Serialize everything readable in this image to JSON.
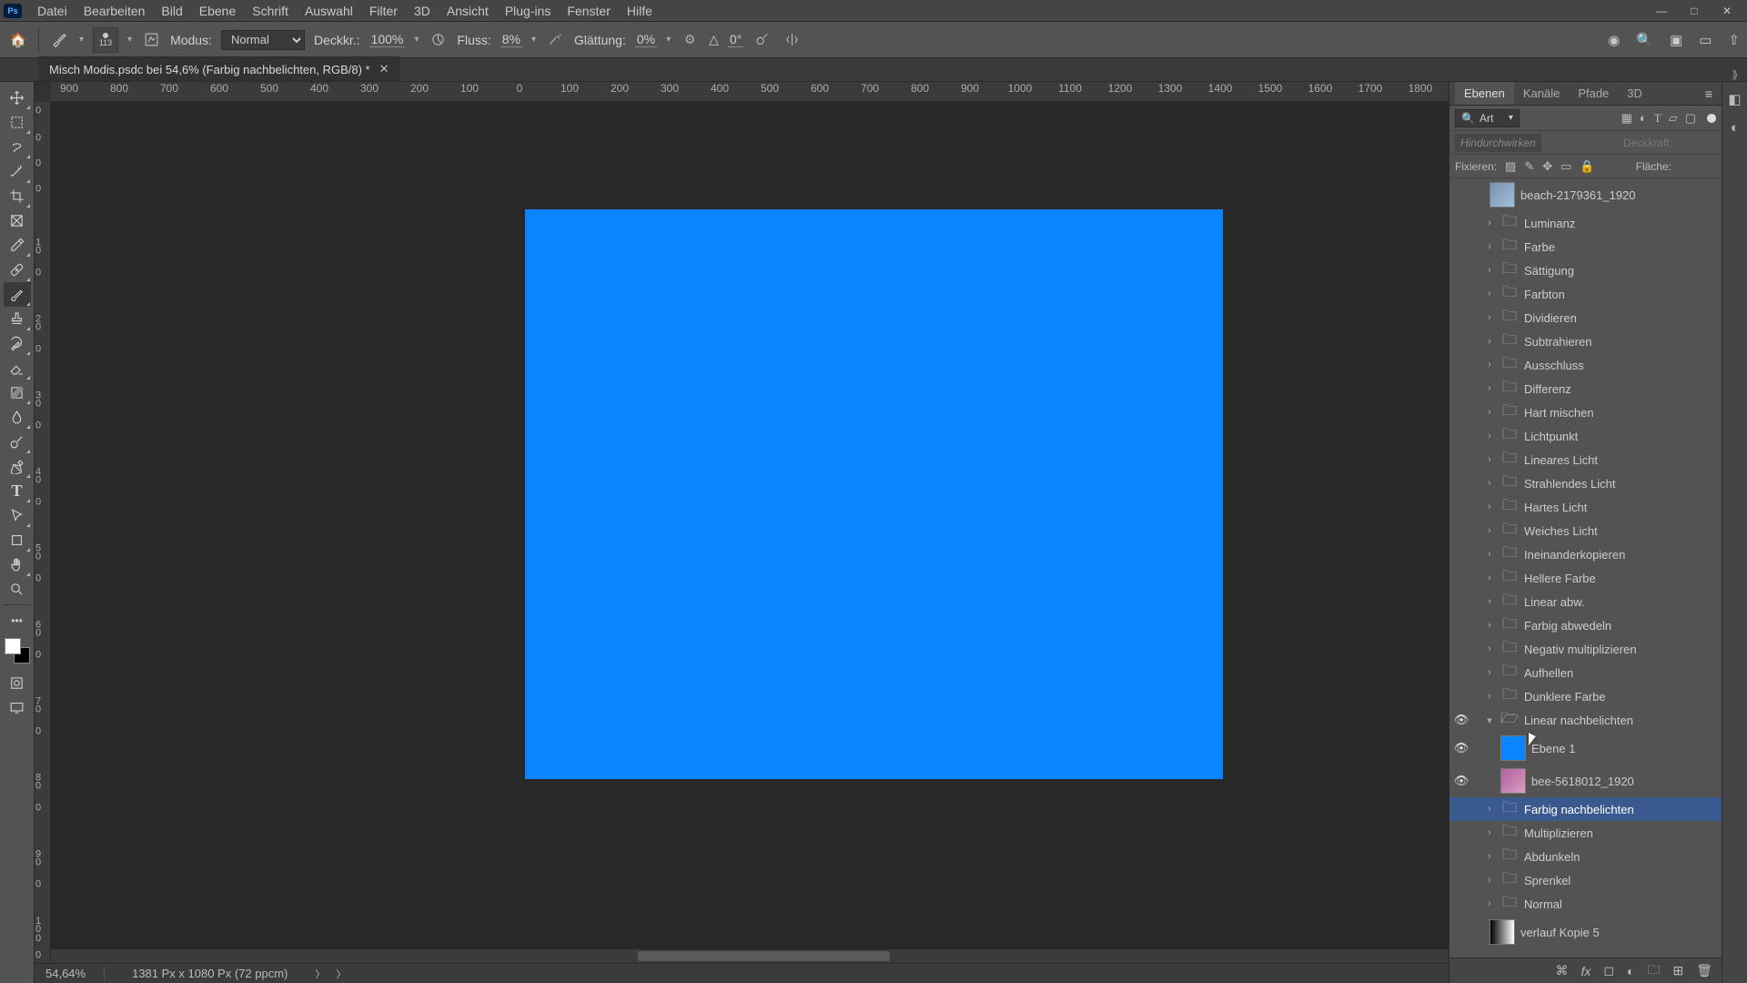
{
  "app": {
    "logo": "Ps"
  },
  "menus": [
    "Datei",
    "Bearbeiten",
    "Bild",
    "Ebene",
    "Schrift",
    "Auswahl",
    "Filter",
    "3D",
    "Ansicht",
    "Plug-ins",
    "Fenster",
    "Hilfe"
  ],
  "options": {
    "brush_size": "113",
    "mode_label": "Modus:",
    "mode_value": "Normal",
    "opacity_label": "Deckkr.:",
    "opacity_value": "100%",
    "flow_label": "Fluss:",
    "flow_value": "8%",
    "smooth_label": "Glättung:",
    "smooth_value": "0%",
    "angle_label": "△",
    "angle_value": "0°"
  },
  "tab": {
    "title": "Misch Modis.psdc bei 54,6% (Farbig nachbelichten, RGB/8) *"
  },
  "hruler_ticks": [
    {
      "v": "900",
      "p": 20
    },
    {
      "v": "800",
      "p": 75
    },
    {
      "v": "700",
      "p": 130
    },
    {
      "v": "600",
      "p": 185
    },
    {
      "v": "500",
      "p": 240
    },
    {
      "v": "400",
      "p": 295
    },
    {
      "v": "300",
      "p": 350
    },
    {
      "v": "200",
      "p": 405
    },
    {
      "v": "100",
      "p": 460
    },
    {
      "v": "0",
      "p": 515
    },
    {
      "v": "100",
      "p": 570
    },
    {
      "v": "200",
      "p": 625
    },
    {
      "v": "300",
      "p": 680
    },
    {
      "v": "400",
      "p": 735
    },
    {
      "v": "500",
      "p": 790
    },
    {
      "v": "600",
      "p": 845
    },
    {
      "v": "700",
      "p": 900
    },
    {
      "v": "800",
      "p": 955
    },
    {
      "v": "900",
      "p": 1010
    },
    {
      "v": "1000",
      "p": 1065
    },
    {
      "v": "1100",
      "p": 1120
    },
    {
      "v": "1200",
      "p": 1175
    },
    {
      "v": "1300",
      "p": 1230
    },
    {
      "v": "1400",
      "p": 1285
    },
    {
      "v": "1500",
      "p": 1340
    },
    {
      "v": "1600",
      "p": 1395
    },
    {
      "v": "1700",
      "p": 1450
    },
    {
      "v": "1800",
      "p": 1505
    }
  ],
  "vruler_ticks": [
    {
      "v": "0",
      "p": 10
    },
    {
      "v": "0",
      "p": 40
    },
    {
      "v": "0",
      "p": 68
    },
    {
      "v": "0",
      "p": 96
    },
    {
      "v": "10",
      "p": 160
    },
    {
      "v": "0",
      "p": 188
    },
    {
      "v": "20",
      "p": 244
    },
    {
      "v": "0",
      "p": 272
    },
    {
      "v": "30",
      "p": 328
    },
    {
      "v": "0",
      "p": 356
    },
    {
      "v": "40",
      "p": 412
    },
    {
      "v": "0",
      "p": 440
    },
    {
      "v": "50",
      "p": 496
    },
    {
      "v": "0",
      "p": 524
    },
    {
      "v": "60",
      "p": 580
    },
    {
      "v": "0",
      "p": 608
    },
    {
      "v": "70",
      "p": 664
    },
    {
      "v": "0",
      "p": 692
    },
    {
      "v": "80",
      "p": 748
    },
    {
      "v": "0",
      "p": 776
    },
    {
      "v": "90",
      "p": 832
    },
    {
      "v": "0",
      "p": 860
    },
    {
      "v": "100",
      "p": 910
    },
    {
      "v": "0",
      "p": 938
    }
  ],
  "status": {
    "zoom": "54,64%",
    "dims": "1381 Px x 1080 Px (72 ppcm)"
  },
  "panel_tabs": [
    "Ebenen",
    "Kanäle",
    "Pfade",
    "3D"
  ],
  "search": {
    "label": "Art"
  },
  "blend": {
    "placeholder": "Hindurchwirken",
    "opacity_label": "Deckkraft:"
  },
  "lock": {
    "label": "Fixieren:",
    "fill_label": "Fläche:"
  },
  "layers": [
    {
      "vis": false,
      "type": "img",
      "name": "beach-2179361_1920",
      "indent": 1,
      "big": true
    },
    {
      "vis": false,
      "type": "folder",
      "name": "Luminanz",
      "indent": 1
    },
    {
      "vis": false,
      "type": "folder",
      "name": "Farbe",
      "indent": 1
    },
    {
      "vis": false,
      "type": "folder",
      "name": "Sättigung",
      "indent": 1
    },
    {
      "vis": false,
      "type": "folder",
      "name": "Farbton",
      "indent": 1
    },
    {
      "vis": false,
      "type": "folder",
      "name": "Dividieren",
      "indent": 1
    },
    {
      "vis": false,
      "type": "folder",
      "name": "Subtrahieren",
      "indent": 1
    },
    {
      "vis": false,
      "type": "folder",
      "name": "Ausschluss",
      "indent": 1
    },
    {
      "vis": false,
      "type": "folder",
      "name": "Differenz",
      "indent": 1
    },
    {
      "vis": false,
      "type": "folder",
      "name": "Hart mischen",
      "indent": 1
    },
    {
      "vis": false,
      "type": "folder",
      "name": "Lichtpunkt",
      "indent": 1
    },
    {
      "vis": false,
      "type": "folder",
      "name": "Lineares Licht",
      "indent": 1
    },
    {
      "vis": false,
      "type": "folder",
      "name": "Strahlendes Licht",
      "indent": 1
    },
    {
      "vis": false,
      "type": "folder",
      "name": "Hartes Licht",
      "indent": 1
    },
    {
      "vis": false,
      "type": "folder",
      "name": "Weiches Licht",
      "indent": 1
    },
    {
      "vis": false,
      "type": "folder",
      "name": "Ineinanderkopieren",
      "indent": 1
    },
    {
      "vis": false,
      "type": "folder",
      "name": "Hellere Farbe",
      "indent": 1
    },
    {
      "vis": false,
      "type": "folder",
      "name": "Linear abw.",
      "indent": 1
    },
    {
      "vis": false,
      "type": "folder",
      "name": "Farbig abwedeln",
      "indent": 1
    },
    {
      "vis": false,
      "type": "folder",
      "name": "Negativ multiplizieren",
      "indent": 1
    },
    {
      "vis": false,
      "type": "folder",
      "name": "Aufhellen",
      "indent": 1
    },
    {
      "vis": false,
      "type": "folder",
      "name": "Dunklere Farbe",
      "indent": 1
    },
    {
      "vis": true,
      "type": "folder_open",
      "name": "Linear nachbelichten",
      "indent": 1
    },
    {
      "vis": true,
      "type": "blue",
      "name": "Ebene 1",
      "indent": 2,
      "big": true
    },
    {
      "vis": true,
      "type": "img2",
      "name": "bee-5618012_1920",
      "indent": 2,
      "big": true
    },
    {
      "vis": false,
      "type": "folder",
      "name": "Farbig nachbelichten",
      "indent": 1,
      "selected": true
    },
    {
      "vis": false,
      "type": "folder",
      "name": "Multiplizieren",
      "indent": 1
    },
    {
      "vis": false,
      "type": "folder",
      "name": "Abdunkeln",
      "indent": 1
    },
    {
      "vis": false,
      "type": "folder",
      "name": "Sprenkel",
      "indent": 1
    },
    {
      "vis": false,
      "type": "folder",
      "name": "Normal",
      "indent": 1
    },
    {
      "vis": false,
      "type": "grad",
      "name": "verlauf Kopie 5",
      "indent": 1,
      "big": true
    }
  ]
}
